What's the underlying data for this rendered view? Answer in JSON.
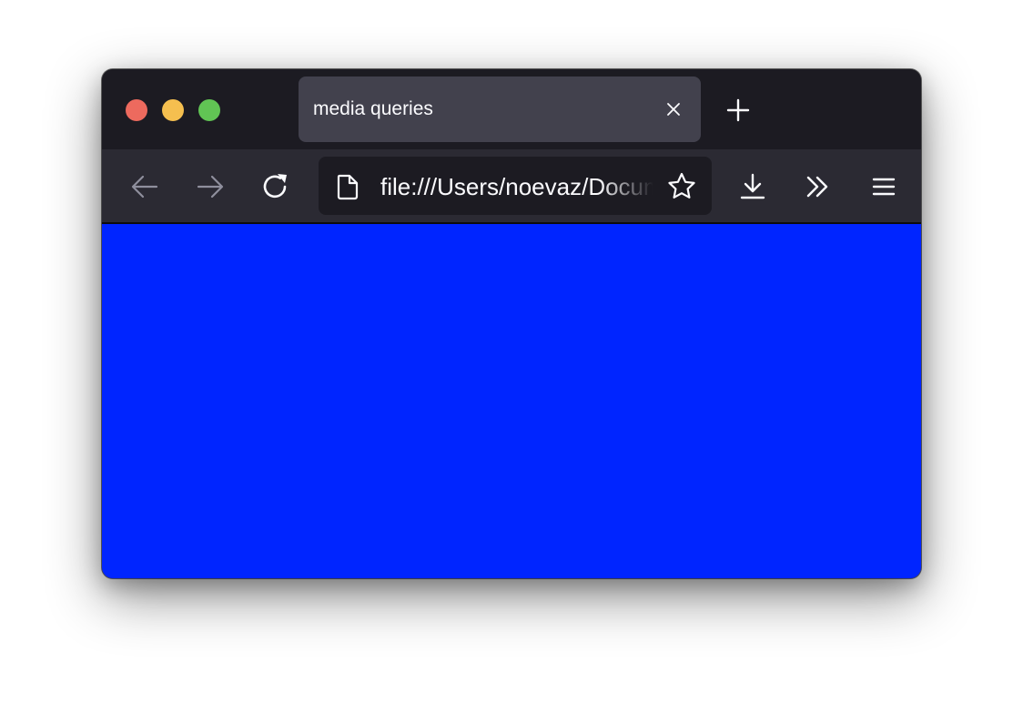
{
  "window": {
    "traffic_lights": {
      "close_color": "#ed6a5e",
      "minimize_color": "#f5bf4f",
      "maximize_color": "#61c554"
    }
  },
  "tabs": [
    {
      "title": "media queries",
      "active": true
    }
  ],
  "toolbar": {
    "icons": {
      "back": "arrow-left-icon",
      "forward": "arrow-right-icon",
      "reload": "reload-icon",
      "page": "document-icon",
      "bookmark": "star-icon",
      "downloads": "download-icon",
      "overflow": "double-chevron-icon",
      "menu": "hamburger-menu-icon",
      "new_tab": "plus-icon",
      "close_tab": "close-icon"
    },
    "back_enabled": false,
    "forward_enabled": false
  },
  "urlbar": {
    "url": "file:///Users/noevaz/Documents"
  },
  "page": {
    "background_color": "#0025ff"
  }
}
